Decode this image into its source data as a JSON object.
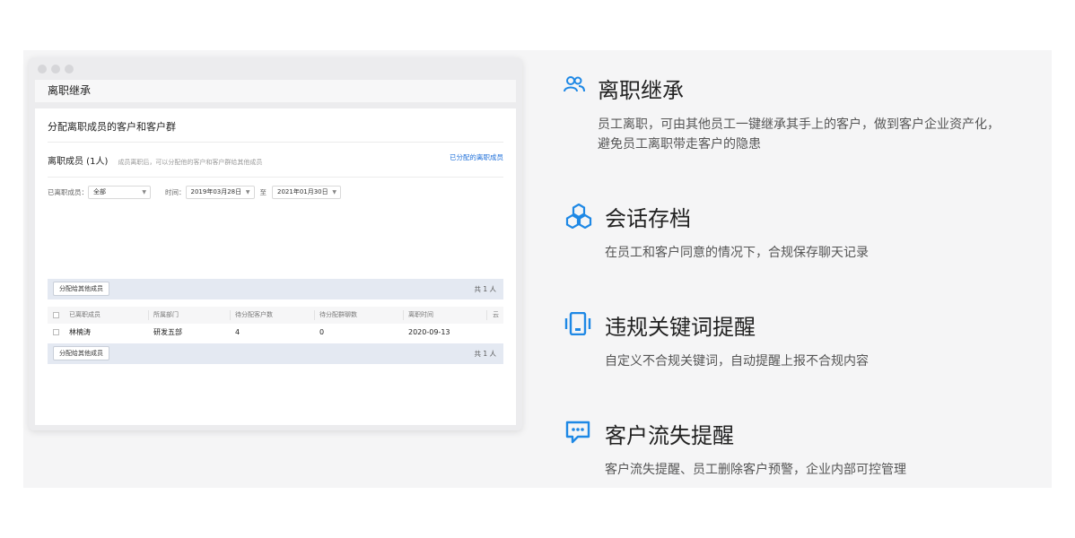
{
  "mock_window": {
    "title": "离职继承",
    "section_title": "分配离职成员的客户和客户群",
    "members_label": "离职成员 (1人)",
    "members_hint": "成员离职后，可以分配他的客户和客户群给其他成员",
    "assigned_link": "已分配的离职成员",
    "filters": {
      "member_label": "已离职成员：",
      "member_value": "全部",
      "time_label": "时间：",
      "start_date": "2019年03月28日",
      "to_label": "至",
      "end_date": "2021年01月30日"
    },
    "assign_button": "分配给其他成员",
    "count_text": "共 1 人",
    "table": {
      "headers": [
        "已离职成员",
        "所属部门",
        "待分配客户数",
        "待分配群聊数",
        "离职时间",
        "云"
      ],
      "rows": [
        [
          "林楠涛",
          "研发五部",
          "4",
          "0",
          "2020-09-13"
        ]
      ]
    }
  },
  "features": [
    {
      "icon": "users-icon",
      "title": "离职继承",
      "desc": [
        "员工离职，可由其他员工一键继承其手上的客户，做到客户企业资产化，",
        "避免员工离职带走客户的隐患"
      ]
    },
    {
      "icon": "hexagon-cluster-icon",
      "title": "会话存档",
      "desc": [
        "在员工和客户同意的情况下，合规保存聊天记录"
      ]
    },
    {
      "icon": "phone-vibrate-icon",
      "title": "违规关键词提醒",
      "desc": [
        "自定义不合规关键词，自动提醒上报不合规内容"
      ]
    },
    {
      "icon": "chat-alert-icon",
      "title": "客户流失提醒",
      "desc": [
        "客户流失提醒、员工删除客户预警，企业内部可控管理"
      ]
    }
  ],
  "colors": {
    "accent": "#1e88e5",
    "link": "#1e6fd9",
    "panel_bg": "#f5f5f6",
    "table_bar": "#e4e9f2"
  }
}
